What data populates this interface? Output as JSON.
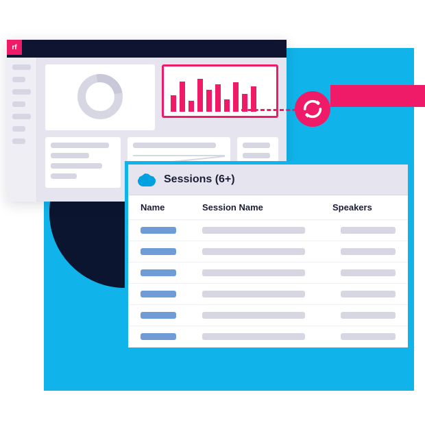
{
  "rf_badge": "rf",
  "chart_data": {
    "type": "bar",
    "values": [
      40,
      74,
      26,
      80,
      54,
      66,
      30,
      72,
      44,
      62
    ],
    "ylim": [
      0,
      100
    ],
    "title": "",
    "xlabel": "",
    "ylabel": ""
  },
  "sync_icon": "sync-icon",
  "data_window": {
    "icon": "salesforce-cloud",
    "title": "Sessions (6+)",
    "columns": {
      "name": "Name",
      "session": "Session Name",
      "speakers": "Speakers"
    },
    "row_count": 6
  }
}
